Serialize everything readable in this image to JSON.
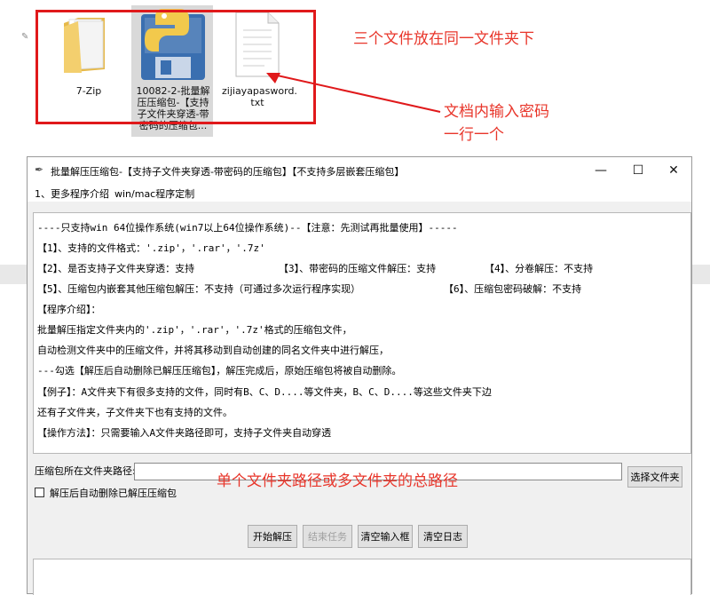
{
  "files": [
    {
      "name": "7-Zip",
      "icon": "folder-icon"
    },
    {
      "name": "10082-2-批量解压压缩包-【支持子文件夹穿透-带密码的压缩包】",
      "lines": [
        "10082-2-批量解",
        "压压缩包-【支持",
        "子文件夹穿透-带",
        "密码的压缩包..."
      ],
      "icon": "python-file-icon"
    },
    {
      "name": "zijiayapasword.txt",
      "lines": [
        "zijiayapasword.",
        "txt"
      ],
      "icon": "text-file-icon"
    }
  ],
  "annotations": {
    "same_folder": "三个文件放在同一文件夹下",
    "password_note_line1": "文档内输入密码",
    "password_note_line2": "一行一个",
    "path_note": "单个文件夹路径或多文件夹的总路径"
  },
  "window": {
    "title": "批量解压压缩包-【支持子文件夹穿透-带密码的压缩包】【不支持多层嵌套压缩包】",
    "minimize": "—",
    "maximize": "☐",
    "close": "✕",
    "menu": [
      "1、更多程序介绍",
      "win/mac程序定制"
    ]
  },
  "info_lines": [
    "----只支持win 64位操作系统(win7以上64位操作系统)--【注意：先测试再批量使用】-----",
    "【1】、支持的文件格式：'.zip'，'.rar'，'.7z'",
    "【2】、是否支持子文件夹穿透：支持",
    "【3】、带密码的压缩文件解压：支持",
    "【4】、分卷解压：不支持",
    "【5】、压缩包内嵌套其他压缩包解压：不支持（可通过多次运行程序实现）",
    "【6】、压缩包密码破解：不支持",
    "【程序介绍】：",
    "批量解压指定文件夹内的'.zip'，'.rar'，'.7z'格式的压缩包文件，",
    "自动检测文件夹中的压缩文件，并将其移动到自动创建的同名文件夹中进行解压，",
    "---勾选【解压后自动删除已解压压缩包】，解压完成后，原始压缩包将被自动删除。",
    "【例子】：A文件夹下有很多支持的文件，同时有B、C、D....等文件夹，B、C、D....等这些文件夹下边",
    "还有子文件夹，子文件夹下也有支持的文件。",
    "【操作方法】：只需要输入A文件夹路径即可，支持子文件夹自动穿透"
  ],
  "form": {
    "path_label": "压缩包所在文件夹路径:",
    "path_value": "",
    "browse_button": "选择文件夹",
    "delete_checkbox_label": "解压后自动删除已解压压缩包",
    "delete_checked": false
  },
  "buttons": {
    "start": "开始解压",
    "stop": "结束任务",
    "clear_input": "清空输入框",
    "clear_log": "清空日志"
  }
}
